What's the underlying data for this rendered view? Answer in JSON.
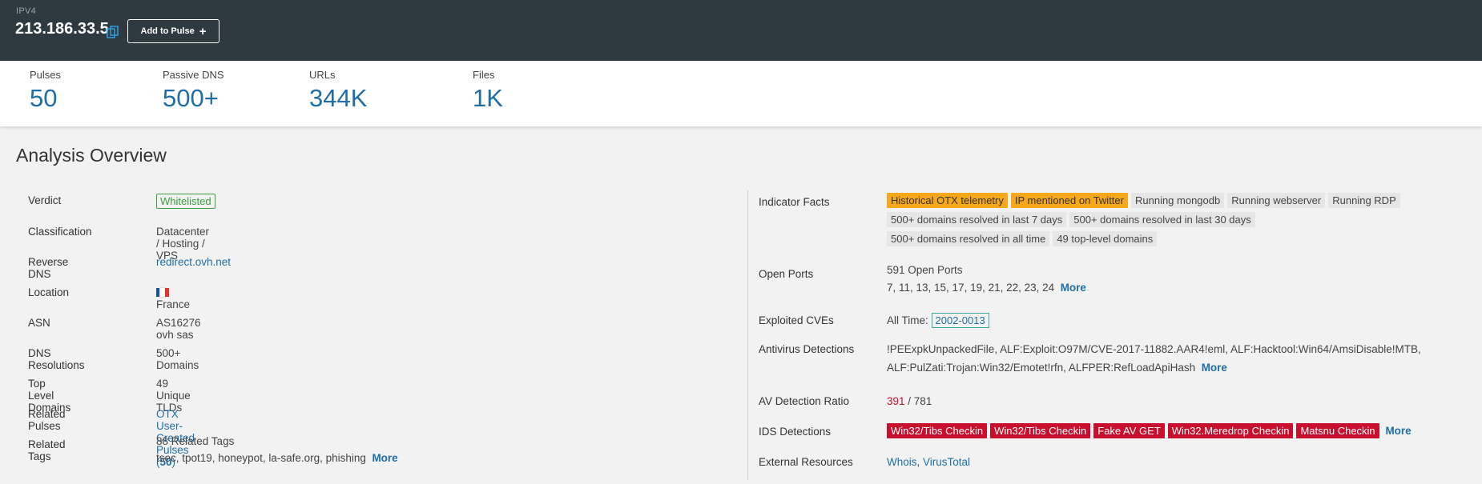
{
  "header": {
    "ip_type": "IPV4",
    "ip_address": "213.186.33.5",
    "add_to_pulse_label": "Add to Pulse",
    "add_to_pulse_icon": "+"
  },
  "stats": {
    "pulses": {
      "label": "Pulses",
      "value": "50"
    },
    "passive_dns": {
      "label": "Passive DNS",
      "value": "500+"
    },
    "urls": {
      "label": "URLs",
      "value": "344K"
    },
    "files": {
      "label": "Files",
      "value": "1K"
    }
  },
  "section_title": "Analysis Overview",
  "left": {
    "verdict": {
      "label": "Verdict",
      "value": "Whitelisted"
    },
    "classification": {
      "label": "Classification",
      "value": "Datacenter / Hosting / VPS"
    },
    "reverse_dns": {
      "label": "Reverse DNS",
      "value": "redirect.ovh.net"
    },
    "location": {
      "label": "Location",
      "value": "France",
      "flag_colors": [
        "#1f4fa5",
        "#ffffff",
        "#e3342f"
      ]
    },
    "asn": {
      "label": "ASN",
      "value": "AS16276 ovh sas"
    },
    "dns_resolutions": {
      "label": "DNS Resolutions",
      "value": "500+ Domains"
    },
    "tlds": {
      "label": "Top Level Domains",
      "value": "49 Unique TLDs"
    },
    "related_pulses": {
      "label": "Related Pulses",
      "value_prefix": "OTX User-Created Pulses (",
      "count": "50",
      "value_suffix": ")"
    },
    "related_tags": {
      "label": "Related Tags",
      "summary": "88 Related Tags",
      "tags": "tsec,  tpot19,  honeypot,  la-safe.org,  phishing",
      "more": "More"
    }
  },
  "right": {
    "indicator_facts": {
      "label": "Indicator Facts",
      "row1": [
        "Historical OTX telemetry",
        "IP mentioned on Twitter",
        "Running mongodb",
        "Running webserver",
        "Running RDP"
      ],
      "row2": [
        "500+ domains resolved in last 7 days",
        "500+ domains resolved in last 30 days"
      ],
      "row3": [
        "500+ domains resolved in all time",
        "49 top-level domains"
      ]
    },
    "open_ports": {
      "label": "Open Ports",
      "summary": "591 Open Ports",
      "ports": "7,  11,  13,  15,  17,  19,  21,  22,  23,  24",
      "more": "More"
    },
    "exploited_cves": {
      "label": "Exploited CVEs",
      "prefix": "All Time:",
      "cve": "2002-0013"
    },
    "antivirus": {
      "label": "Antivirus Detections",
      "line1": "!PEExpkUnpackedFile,  ALF:Exploit:O97M/CVE-2017-11882.AAR4!eml,  ALF:Hacktool:Win64/AmsiDisable!MTB,",
      "line2": "ALF:PulZati:Trojan:Win32/Emotet!rfn,  ALFPER:RefLoadApiHash",
      "more": "More"
    },
    "av_ratio": {
      "label": "AV Detection Ratio",
      "detected": "391",
      "separator": " / ",
      "total": "781"
    },
    "ids": {
      "label": "IDS Detections",
      "items": [
        "Win32/Tibs Checkin",
        "Win32/Tibs Checkin",
        "Fake AV GET",
        "Win32.Meredrop Checkin",
        "Matsnu Checkin"
      ],
      "more": "More"
    },
    "external": {
      "label": "External Resources",
      "whois": "Whois",
      "separator": ", ",
      "virustotal": "VirusTotal"
    }
  },
  "colors": {
    "header_bg": "#2f3940",
    "link": "#1f6ea5",
    "stat_value": "#1f6ea5",
    "whitelisted": "#3f9e3f",
    "tag_orange": "#f7a71a",
    "tag_gray": "#e6e6e6",
    "tag_red": "#c8102e"
  }
}
